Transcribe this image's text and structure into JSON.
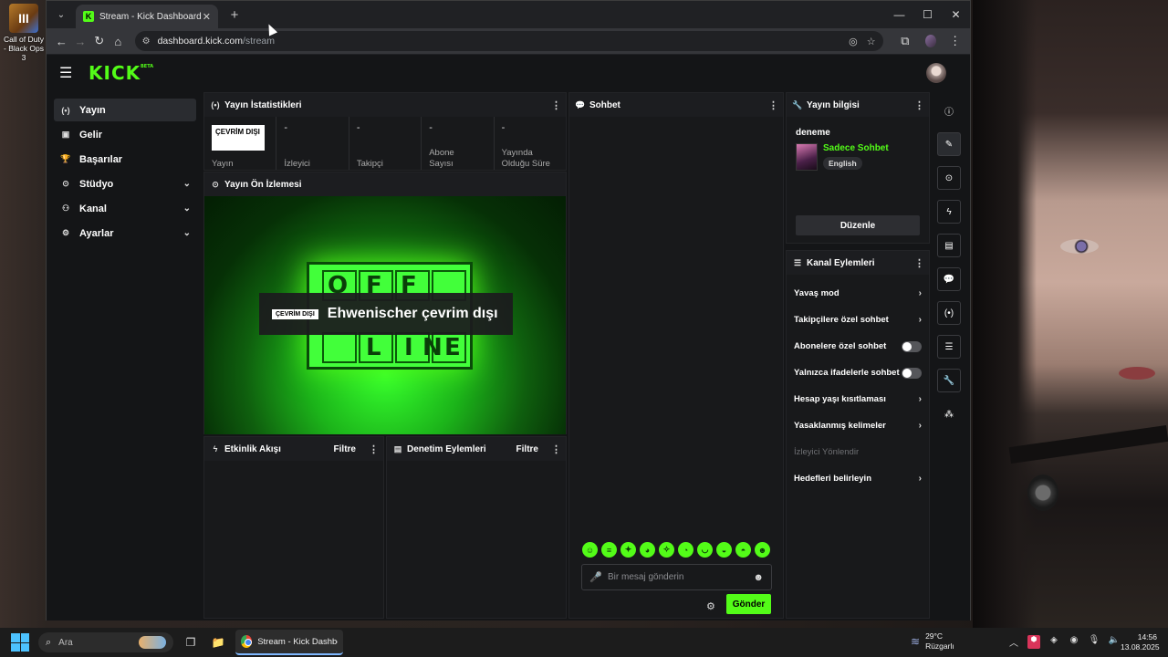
{
  "desktop": {
    "icon_label": "Call of Duty - Black Ops 3",
    "icon_glyph": "III"
  },
  "browser": {
    "tab_title": "Stream - Kick Dashboard",
    "tab_favicon": "K",
    "new_tab_icon": "+",
    "tab_close_icon": "✕",
    "url_host": "dashboard.kick.com",
    "url_path": "/stream",
    "controls": {
      "minimize": "—",
      "maximize": "☐",
      "close": "✕"
    }
  },
  "app": {
    "logo": "KICK",
    "logo_tag": "BETA",
    "accent_color": "#53fc18"
  },
  "sidebar": {
    "items": [
      {
        "label": "Yayın",
        "icon": "broadcast-icon",
        "glyph": "(•)",
        "active": true,
        "expandable": false
      },
      {
        "label": "Gelir",
        "icon": "wallet-icon",
        "glyph": "▣",
        "active": false,
        "expandable": false
      },
      {
        "label": "Başarılar",
        "icon": "trophy-icon",
        "glyph": "🏆",
        "active": false,
        "expandable": false
      },
      {
        "label": "Stüdyo",
        "icon": "camera-icon",
        "glyph": "⊙",
        "active": false,
        "expandable": true
      },
      {
        "label": "Kanal",
        "icon": "users-icon",
        "glyph": "⚇",
        "active": false,
        "expandable": true
      },
      {
        "label": "Ayarlar",
        "icon": "gear-icon",
        "glyph": "⚙",
        "active": false,
        "expandable": true
      }
    ]
  },
  "stats": {
    "title": "Yayın İstatistikleri",
    "status_badge": "ÇEVRİM DIŞI",
    "status_label": "Yayın",
    "cells": [
      {
        "value": "-",
        "label": "İzleyici"
      },
      {
        "value": "-",
        "label": "Takipçi"
      },
      {
        "value": "-",
        "label": "Abone Sayısı"
      },
      {
        "value": "-",
        "label": "Yayında Olduğu Süre"
      }
    ]
  },
  "preview": {
    "title": "Yayın Ön İzlemesi",
    "offline_badge": "ÇEVRİM DIŞI",
    "offline_message": "Ehwenischer çevrim dışı",
    "sign_top": [
      "O",
      "F",
      "F",
      ""
    ],
    "sign_bottom": [
      "",
      "L",
      "I",
      "N",
      "E"
    ]
  },
  "activity": {
    "title": "Etkinlik Akışı",
    "filter": "Filtre"
  },
  "moderation": {
    "title": "Denetim Eylemleri",
    "filter": "Filtre"
  },
  "chat": {
    "title": "Sohbet",
    "placeholder": "Bir mesaj gönderin",
    "send": "Gönder",
    "emotes": [
      "☺",
      "≡",
      "✦",
      "◕",
      "✧",
      "◔",
      "◡",
      "◒",
      "◓",
      "☻"
    ]
  },
  "stream_info": {
    "title": "Yayın bilgisi",
    "stream_title": "deneme",
    "category": "Sadece Sohbet",
    "language": "English",
    "edit": "Düzenle"
  },
  "channel_actions": {
    "title": "Kanal Eylemleri",
    "items": [
      {
        "label": "Yavaş mod",
        "type": "chevron"
      },
      {
        "label": "Takipçilere özel sohbet",
        "type": "chevron"
      },
      {
        "label": "Abonelere özel sohbet",
        "type": "toggle"
      },
      {
        "label": "Yalnızca ifadelerle sohbet",
        "type": "toggle"
      },
      {
        "label": "Hesap yaşı kısıtlaması",
        "type": "chevron"
      },
      {
        "label": "Yasaklanmış kelimeler",
        "type": "chevron"
      },
      {
        "label": "İzleyici Yönlendir",
        "type": "disabled"
      },
      {
        "label": "Hedefleri belirleyin",
        "type": "chevron"
      }
    ]
  },
  "right_rail": [
    {
      "name": "info-icon",
      "glyph": "ⓘ"
    },
    {
      "name": "pencil-icon",
      "glyph": "✎"
    },
    {
      "name": "camera-icon",
      "glyph": "⊙"
    },
    {
      "name": "lightning-icon",
      "glyph": "ϟ"
    },
    {
      "name": "document-icon",
      "glyph": "▤"
    },
    {
      "name": "chat-icon",
      "glyph": "💬"
    },
    {
      "name": "broadcast-icon",
      "glyph": "(•)"
    },
    {
      "name": "list-icon",
      "glyph": "☰"
    },
    {
      "name": "wrench-icon",
      "glyph": "🔧"
    },
    {
      "name": "dots-icon",
      "glyph": "⁂"
    }
  ],
  "taskbar": {
    "search_placeholder": "Ara",
    "chrome_label": "Stream - Kick Dashboar",
    "weather_temp": "29°C",
    "weather_desc": "Rüzgarlı",
    "time": "14:56",
    "date": "13.08.2025"
  }
}
